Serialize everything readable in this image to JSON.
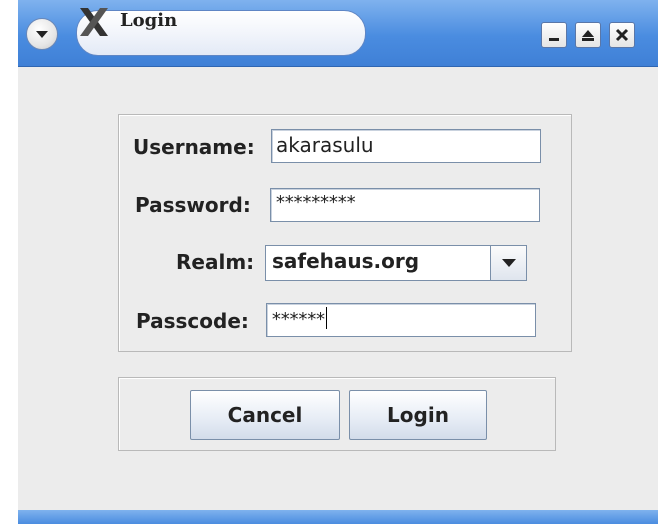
{
  "window": {
    "title": "Login",
    "title_icon": "x-logo-icon",
    "menu_icon": "chevron-down-icon",
    "controls": [
      "minimize-icon",
      "maximize-icon",
      "close-icon"
    ]
  },
  "form": {
    "username_label": "Username:",
    "username_value": "akarasulu",
    "password_label": "Password:",
    "password_value": "*********",
    "realm_label": "Realm:",
    "realm_value": "safehaus.org",
    "passcode_label": "Passcode:",
    "passcode_value": "******"
  },
  "buttons": {
    "cancel_label": "Cancel",
    "login_label": "Login"
  },
  "colors": {
    "titlebar": "#4a8ce0",
    "window_bg": "#ececec"
  }
}
